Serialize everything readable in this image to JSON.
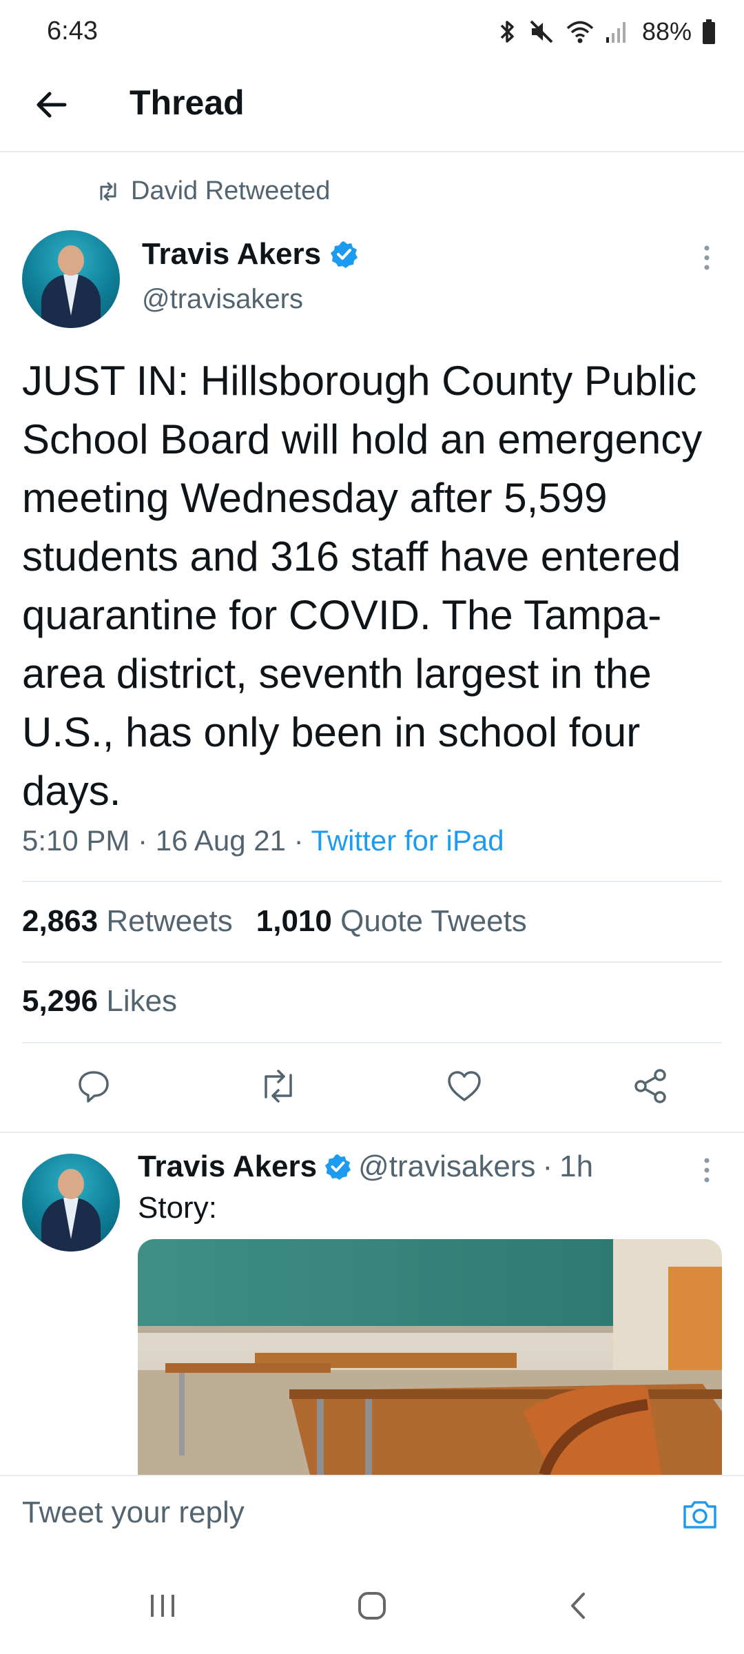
{
  "status_bar": {
    "time": "6:43",
    "battery": "88%"
  },
  "header": {
    "title": "Thread"
  },
  "retweet_context": {
    "label": "David Retweeted"
  },
  "tweet": {
    "author_name": "Travis Akers",
    "author_handle": "@travisakers",
    "text": "JUST IN: Hillsborough County Public School Board will hold an emergency meeting Wednesday after 5,599 students and 316 staff have entered quarantine for COVID. The Tampa-area district, seventh largest in the U.S., has only been in school four days.",
    "time": "5:10 PM",
    "date": "16 Aug 21",
    "source": "Twitter for iPad",
    "retweets_count": "2,863",
    "retweets_label": "Retweets",
    "quote_count": "1,010",
    "quote_label": "Quote Tweets",
    "likes_count": "5,296",
    "likes_label": "Likes"
  },
  "reply": {
    "author_name": "Travis Akers",
    "author_handle": "@travisakers",
    "age": "1h",
    "text": "Story:"
  },
  "composer": {
    "placeholder": "Tweet your reply"
  },
  "colors": {
    "accent": "#1d9bf0",
    "secondary_text": "#536471",
    "primary_text": "#0f1419"
  },
  "icons": {
    "back": "arrow-left-icon",
    "verified": "verified-badge-icon",
    "more": "more-vertical-icon",
    "reply": "reply-icon",
    "retweet": "retweet-icon",
    "like": "heart-icon",
    "share": "share-icon",
    "camera": "camera-icon"
  }
}
